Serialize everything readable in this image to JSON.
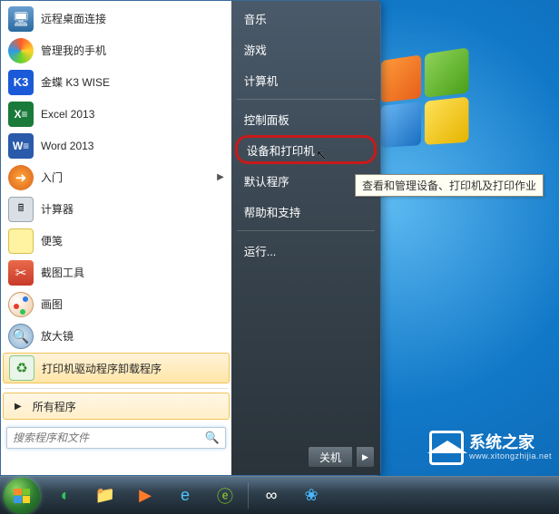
{
  "left_items": [
    {
      "label": "远程桌面连接",
      "icon_name": "remote-desktop-icon",
      "cls": "ic-remote",
      "glyph": "🖥"
    },
    {
      "label": "管理我的手机",
      "icon_name": "phone-manager-icon",
      "cls": "ic-phone",
      "glyph": ""
    },
    {
      "label": "金蝶 K3 WISE",
      "icon_name": "kingdee-k3-icon",
      "cls": "ic-k3",
      "glyph": "K3"
    },
    {
      "label": "Excel 2013",
      "icon_name": "excel-icon",
      "cls": "ic-excel",
      "glyph": "X≡"
    },
    {
      "label": "Word 2013",
      "icon_name": "word-icon",
      "cls": "ic-word",
      "glyph": "W≡"
    },
    {
      "label": "入门",
      "icon_name": "getting-started-icon",
      "cls": "ic-started",
      "glyph": "➜",
      "expandable": true
    },
    {
      "label": "计算器",
      "icon_name": "calculator-icon",
      "cls": "ic-calc",
      "glyph": "🖩"
    },
    {
      "label": "便笺",
      "icon_name": "sticky-notes-icon",
      "cls": "ic-notes",
      "glyph": ""
    },
    {
      "label": "截图工具",
      "icon_name": "snipping-tool-icon",
      "cls": "ic-snip",
      "glyph": "✂"
    },
    {
      "label": "画图",
      "icon_name": "paint-icon",
      "cls": "ic-paint",
      "glyph": ""
    },
    {
      "label": "放大镜",
      "icon_name": "magnifier-icon",
      "cls": "ic-mag",
      "glyph": "🔍"
    },
    {
      "label": "打印机驱动程序卸载程序",
      "icon_name": "printer-uninstall-icon",
      "cls": "ic-uninst",
      "glyph": "♻",
      "highlighted": true
    }
  ],
  "all_programs_label": "所有程序",
  "search": {
    "placeholder": "搜索程序和文件"
  },
  "right_items": [
    {
      "label": "音乐",
      "name": "music"
    },
    {
      "label": "游戏",
      "name": "games"
    },
    {
      "label": "计算机",
      "name": "computer"
    },
    {
      "sep": true
    },
    {
      "label": "控制面板",
      "name": "control-panel"
    },
    {
      "label": "设备和打印机",
      "name": "devices-printers",
      "highlighted": true
    },
    {
      "label": "默认程序",
      "name": "default-programs"
    },
    {
      "label": "帮助和支持",
      "name": "help-support"
    },
    {
      "sep": true
    },
    {
      "label": "运行...",
      "name": "run"
    }
  ],
  "shutdown_label": "关机",
  "tooltip_text": "查看和管理设备、打印机及打印作业",
  "watermark": {
    "title": "系统之家",
    "url": "www.xitongzhijia.net"
  },
  "taskbar_icons": [
    {
      "name": "qihoo-icon",
      "glyph": "◐",
      "color": "#2ac85a"
    },
    {
      "name": "explorer-icon",
      "glyph": "📁",
      "color": "#ffd060"
    },
    {
      "name": "media-player-icon",
      "glyph": "▶",
      "color": "#ff7a2a"
    },
    {
      "name": "ie-icon",
      "glyph": "e",
      "color": "#4ac8ff"
    },
    {
      "name": "ie10-icon",
      "glyph": "ⓔ",
      "color": "#8ad22a"
    },
    {
      "name": "cloud-app-icon",
      "glyph": "∞",
      "color": "#ffffff"
    },
    {
      "name": "baidu-icon",
      "glyph": "❀",
      "color": "#4ab8ff"
    }
  ]
}
